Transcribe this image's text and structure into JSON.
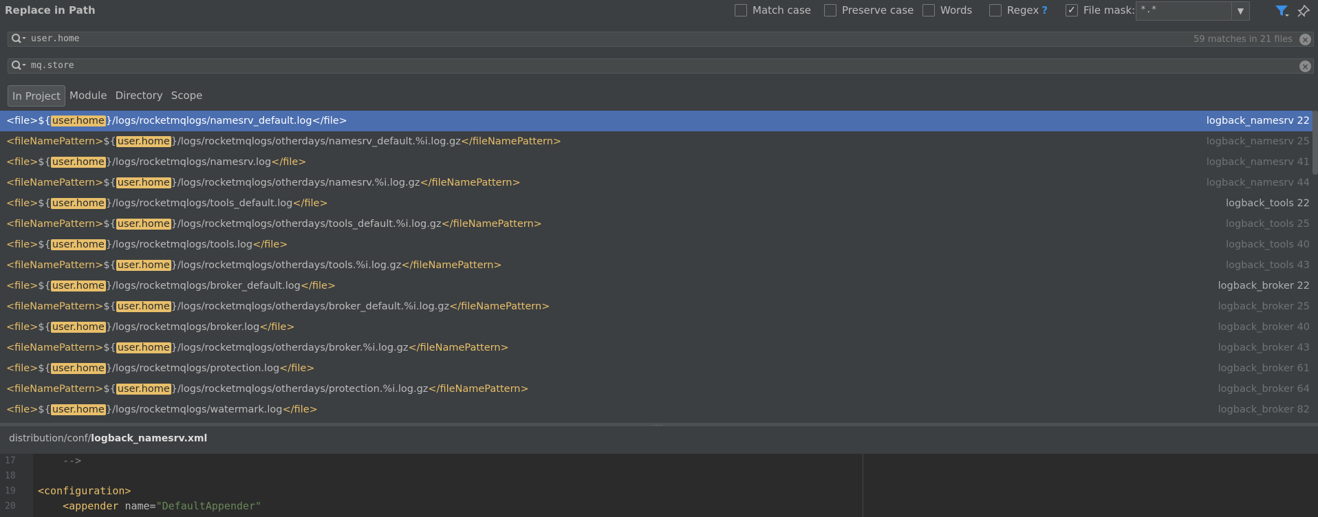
{
  "header": {
    "title": "Replace in Path",
    "options": [
      {
        "label": "Match case",
        "checked": false
      },
      {
        "label": "Preserve case",
        "checked": false
      },
      {
        "label": "Words",
        "checked": false
      },
      {
        "label": "Regex",
        "checked": false,
        "help": "?"
      },
      {
        "label": "File mask:",
        "checked": true
      }
    ],
    "file_mask_value": "*.*"
  },
  "search": {
    "find_text": "user.home",
    "match_count": "59 matches in 21 files",
    "replace_text": "mq.store"
  },
  "scope_tabs": [
    "In Project",
    "Module",
    "Directory",
    "Scope"
  ],
  "active_scope": "In Project",
  "results": [
    {
      "open": "<file>",
      "prefix": "${",
      "match": "user.home",
      "rest": "}/logs/rocketmqlogs/namesrv_default.log",
      "close": "</file>",
      "file": "logback_namesrv",
      "line": "22",
      "selected": true
    },
    {
      "open": "<fileNamePattern>",
      "prefix": "${",
      "match": "user.home",
      "rest": "}/logs/rocketmqlogs/otherdays/namesrv_default.%i.log.gz",
      "close": "</fileNamePattern>",
      "file": "logback_namesrv",
      "line": "25"
    },
    {
      "open": "<file>",
      "prefix": "${",
      "match": "user.home",
      "rest": "}/logs/rocketmqlogs/namesrv.log",
      "close": "</file>",
      "file": "logback_namesrv",
      "line": "41"
    },
    {
      "open": "<fileNamePattern>",
      "prefix": "${",
      "match": "user.home",
      "rest": "}/logs/rocketmqlogs/otherdays/namesrv.%i.log.gz",
      "close": "</fileNamePattern>",
      "file": "logback_namesrv",
      "line": "44"
    },
    {
      "open": "<file>",
      "prefix": "${",
      "match": "user.home",
      "rest": "}/logs/rocketmqlogs/tools_default.log",
      "close": "</file>",
      "file": "logback_tools",
      "line": "22",
      "strong": true
    },
    {
      "open": "<fileNamePattern>",
      "prefix": "${",
      "match": "user.home",
      "rest": "}/logs/rocketmqlogs/otherdays/tools_default.%i.log.gz",
      "close": "</fileNamePattern>",
      "file": "logback_tools",
      "line": "25"
    },
    {
      "open": "<file>",
      "prefix": "${",
      "match": "user.home",
      "rest": "}/logs/rocketmqlogs/tools.log",
      "close": "</file>",
      "file": "logback_tools",
      "line": "40"
    },
    {
      "open": "<fileNamePattern>",
      "prefix": "${",
      "match": "user.home",
      "rest": "}/logs/rocketmqlogs/otherdays/tools.%i.log.gz",
      "close": "</fileNamePattern>",
      "file": "logback_tools",
      "line": "43"
    },
    {
      "open": "<file>",
      "prefix": "${",
      "match": "user.home",
      "rest": "}/logs/rocketmqlogs/broker_default.log",
      "close": "</file>",
      "file": "logback_broker",
      "line": "22",
      "strong": true
    },
    {
      "open": "<fileNamePattern>",
      "prefix": "${",
      "match": "user.home",
      "rest": "}/logs/rocketmqlogs/otherdays/broker_default.%i.log.gz",
      "close": "</fileNamePattern>",
      "file": "logback_broker",
      "line": "25"
    },
    {
      "open": "<file>",
      "prefix": "${",
      "match": "user.home",
      "rest": "}/logs/rocketmqlogs/broker.log",
      "close": "</file>",
      "file": "logback_broker",
      "line": "40"
    },
    {
      "open": "<fileNamePattern>",
      "prefix": "${",
      "match": "user.home",
      "rest": "}/logs/rocketmqlogs/otherdays/broker.%i.log.gz",
      "close": "</fileNamePattern>",
      "file": "logback_broker",
      "line": "43"
    },
    {
      "open": "<file>",
      "prefix": "${",
      "match": "user.home",
      "rest": "}/logs/rocketmqlogs/protection.log",
      "close": "</file>",
      "file": "logback_broker",
      "line": "61"
    },
    {
      "open": "<fileNamePattern>",
      "prefix": "${",
      "match": "user.home",
      "rest": "}/logs/rocketmqlogs/otherdays/protection.%i.log.gz",
      "close": "</fileNamePattern>",
      "file": "logback_broker",
      "line": "64"
    },
    {
      "open": "<file>",
      "prefix": "${",
      "match": "user.home",
      "rest": "}/logs/rocketmqlogs/watermark.log",
      "close": "</file>",
      "file": "logback_broker",
      "line": "82"
    }
  ],
  "preview": {
    "path_dir": "distribution/conf/",
    "path_file": "logback_namesrv.xml",
    "lines": [
      {
        "num": "17",
        "parts": [
          {
            "cls": "c-comment",
            "t": "    -->"
          }
        ]
      },
      {
        "num": "18",
        "parts": []
      },
      {
        "num": "19",
        "parts": [
          {
            "cls": "c-tag",
            "t": "<configuration>"
          }
        ]
      },
      {
        "num": "20",
        "parts": [
          {
            "cls": "c-tag",
            "t": "    <appender "
          },
          {
            "cls": "c-attr",
            "t": "name="
          },
          {
            "cls": "c-val",
            "t": "\"DefaultAppender\""
          }
        ]
      }
    ]
  },
  "colors": {
    "accent": "#4b6eaf",
    "highlight": "#e8bf6a",
    "background": "#3c3f41"
  }
}
